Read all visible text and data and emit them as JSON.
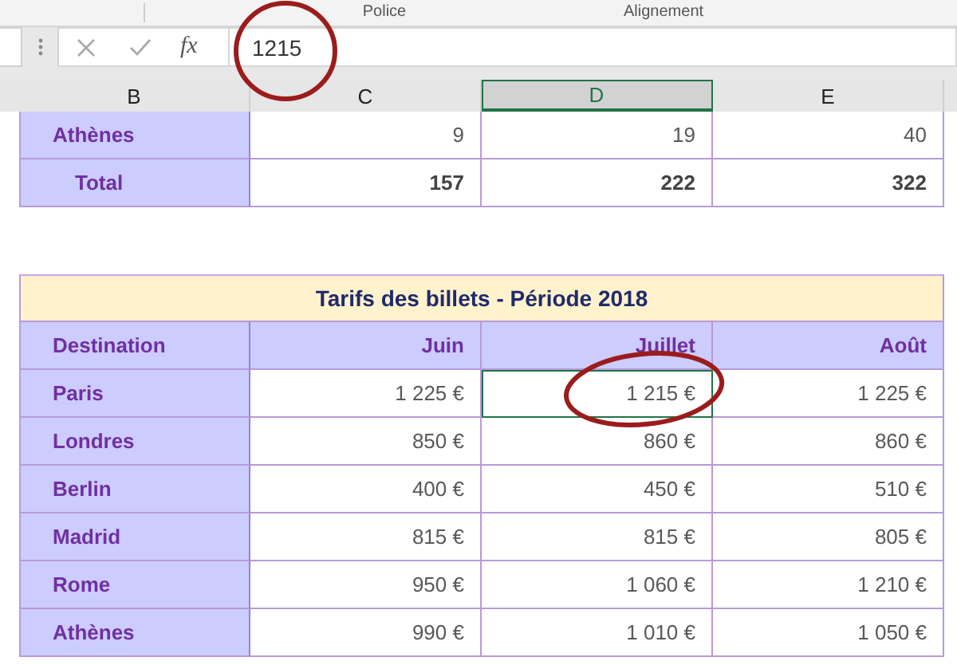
{
  "ribbon": {
    "groups": [
      "Police",
      "Alignement"
    ]
  },
  "formula_bar": {
    "function_label": "fx",
    "value": "1215"
  },
  "columns": [
    {
      "label": "B",
      "selected": false
    },
    {
      "label": "C",
      "selected": false
    },
    {
      "label": "D",
      "selected": true
    },
    {
      "label": "E",
      "selected": false
    }
  ],
  "summary_rows": [
    {
      "kind": "normal",
      "label": "Athènes",
      "cells": [
        "9",
        "19",
        "40"
      ]
    },
    {
      "kind": "total",
      "label": "Total",
      "cells": [
        "157",
        "222",
        "322"
      ]
    }
  ],
  "price_table": {
    "title": "Tarifs des billets - Période 2018",
    "headers": [
      "Destination",
      "Juin",
      "Juillet",
      "Août"
    ],
    "rows": [
      {
        "destination": "Paris",
        "cells": [
          {
            "text": "1 225 €",
            "selected": false
          },
          {
            "text": "1 215 €",
            "selected": true
          },
          {
            "text": "1 225 €",
            "selected": false
          }
        ]
      },
      {
        "destination": "Londres",
        "cells": [
          {
            "text": "850 €",
            "selected": false
          },
          {
            "text": "860 €",
            "selected": false
          },
          {
            "text": "860 €",
            "selected": false
          }
        ]
      },
      {
        "destination": "Berlin",
        "cells": [
          {
            "text": "400 €",
            "selected": false
          },
          {
            "text": "450 €",
            "selected": false
          },
          {
            "text": "510 €",
            "selected": false
          }
        ]
      },
      {
        "destination": "Madrid",
        "cells": [
          {
            "text": "815 €",
            "selected": false
          },
          {
            "text": "815 €",
            "selected": false
          },
          {
            "text": "805 €",
            "selected": false
          }
        ]
      },
      {
        "destination": "Rome",
        "cells": [
          {
            "text": "950 €",
            "selected": false
          },
          {
            "text": "1 060 €",
            "selected": false
          },
          {
            "text": "1 210 €",
            "selected": false
          }
        ]
      },
      {
        "destination": "Athènes",
        "cells": [
          {
            "text": "990 €",
            "selected": false
          },
          {
            "text": "1 010 €",
            "selected": false
          },
          {
            "text": "1 050 €",
            "selected": false
          }
        ]
      }
    ]
  }
}
